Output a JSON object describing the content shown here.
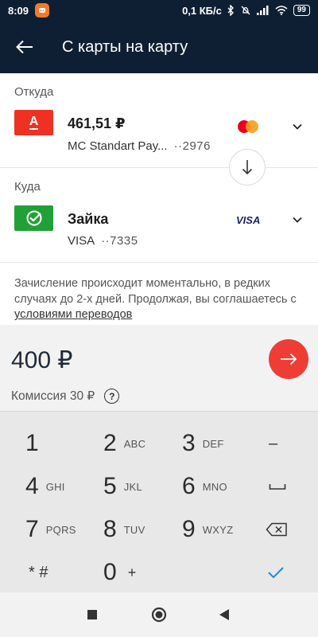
{
  "status_bar": {
    "time": "8:09",
    "speed": "0,1 КБ/с",
    "battery": "99"
  },
  "header": {
    "title": "С карты на карту"
  },
  "from": {
    "label": "Откуда",
    "amount": "461,51 ₽",
    "card_name": "MC Standart Pay...",
    "mask": "··2976",
    "bank_logo_letter": "А",
    "bank_color": "#ef3124",
    "brand": "mastercard"
  },
  "to": {
    "label": "Куда",
    "name": "Зайка",
    "card_name": "VISA",
    "mask": "··7335",
    "bank_color": "#21a038",
    "brand": "VISA"
  },
  "notice": {
    "text": "Зачисление происходит моментально, в редких случаях до 2-х дней. Продолжая, вы соглашаетесь с ",
    "link": "условиями переводов"
  },
  "amount": {
    "value": "400 ₽",
    "fee": "Комиссия 30 ₽",
    "help": "?"
  },
  "keypad": {
    "k1": {
      "num": "1",
      "letters": ""
    },
    "k2": {
      "num": "2",
      "letters": "ABC"
    },
    "k3": {
      "num": "3",
      "letters": "DEF"
    },
    "k4": {
      "num": "4",
      "letters": "GHI"
    },
    "k5": {
      "num": "5",
      "letters": "JKL"
    },
    "k6": {
      "num": "6",
      "letters": "MNO"
    },
    "k7": {
      "num": "7",
      "letters": "PQRS"
    },
    "k8": {
      "num": "8",
      "letters": "TUV"
    },
    "k9": {
      "num": "9",
      "letters": "WXYZ"
    },
    "k0": {
      "num": "0",
      "letters": "+"
    },
    "minus": "–",
    "star": "* #"
  },
  "colors": {
    "header_bg": "#0e1f33",
    "accent_red": "#ee3d35",
    "check_blue": "#1e88e5"
  }
}
